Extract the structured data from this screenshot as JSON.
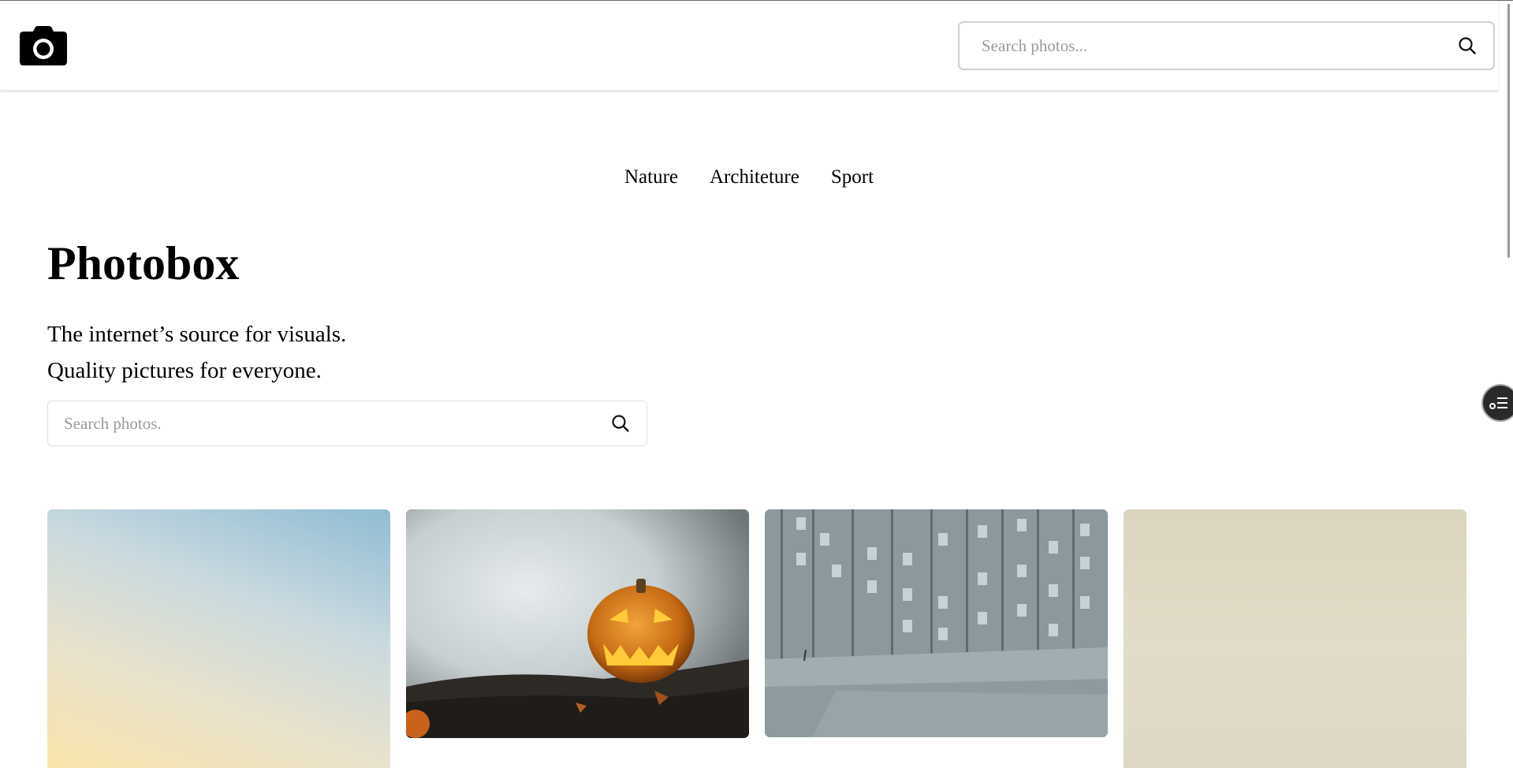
{
  "header": {
    "logo_icon": "camera-icon",
    "search": {
      "placeholder": "Search photos...",
      "icon": "search-icon"
    }
  },
  "nav": {
    "items": [
      {
        "label": "Nature"
      },
      {
        "label": "Architeture"
      },
      {
        "label": "Sport"
      }
    ]
  },
  "hero": {
    "title": "Photobox",
    "subtitle_line1": "The internet’s source for visuals.",
    "subtitle_line2": "Quality pictures for everyone.",
    "search": {
      "placeholder": "Search photos.",
      "icon": "search-icon"
    }
  },
  "gallery": {
    "photos": [
      {
        "subject": "sky gradient"
      },
      {
        "subject": "jack-o-lantern pumpkin in fog"
      },
      {
        "subject": "modern building facade with runner"
      },
      {
        "subject": "beige texture"
      }
    ]
  },
  "floating_widget": {
    "icon": "list-settings-icon"
  },
  "colors": {
    "background": "#ffffff",
    "text": "#000000",
    "placeholder": "#9a9a9a",
    "border": "#d0d0d0"
  }
}
